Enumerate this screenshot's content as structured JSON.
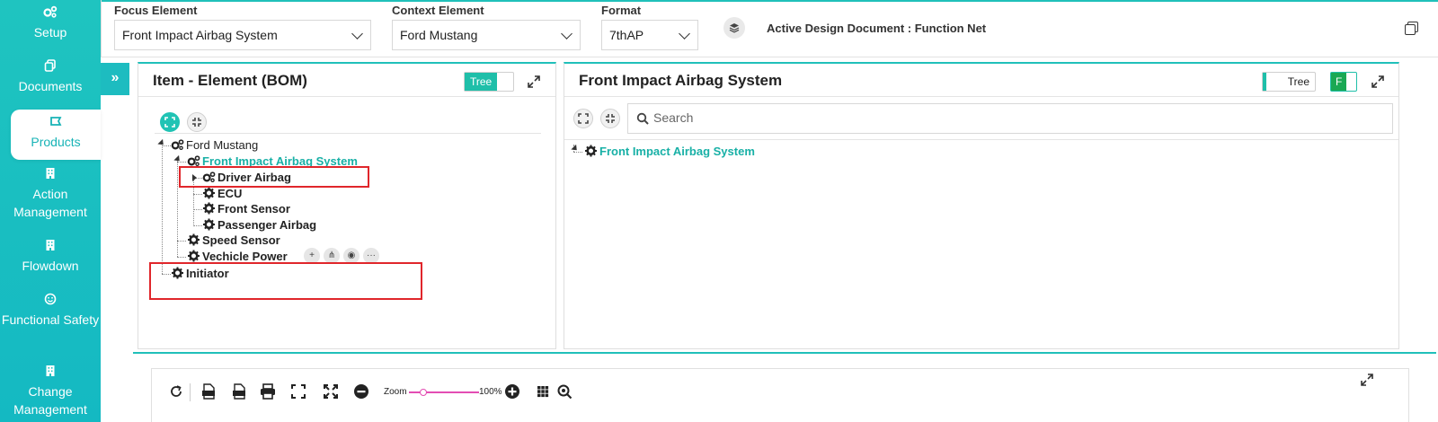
{
  "sidebar": {
    "items": [
      {
        "label": "Setup",
        "icon": "gears-icon"
      },
      {
        "label": "Documents",
        "icon": "copy-icon"
      },
      {
        "label": "Products",
        "icon": "ticket-icon",
        "active": true
      },
      {
        "label": "Action Management",
        "icon": "building-icon"
      },
      {
        "label": "Flowdown",
        "icon": "building-icon"
      },
      {
        "label": "Functional Safety",
        "icon": "smiley-icon"
      },
      {
        "label": "Change Management",
        "icon": "building-icon"
      }
    ]
  },
  "topbar": {
    "focus_label": "Focus Element",
    "focus_value": "Front Impact Airbag System",
    "context_label": "Context Element",
    "context_value": "Ford Mustang",
    "format_label": "Format",
    "format_value": "7thAP",
    "active_doc": "Active Design Document : Function Net"
  },
  "left_panel": {
    "title": "Item - Element (BOM)",
    "toggle_label": "Tree",
    "tree": [
      {
        "label": "Ford Mustang",
        "level": 0
      },
      {
        "label": "Front Impact Airbag System",
        "level": 1
      },
      {
        "label": "Driver Airbag",
        "level": 2
      },
      {
        "label": "ECU",
        "level": 2
      },
      {
        "label": "Front Sensor",
        "level": 2
      },
      {
        "label": "Passenger Airbag",
        "level": 2
      },
      {
        "label": "Speed Sensor",
        "level": 1
      },
      {
        "label": "Vechicle Power",
        "level": 1
      },
      {
        "label": "Initiator",
        "level": 0
      }
    ],
    "row_actions": [
      "+",
      "⋔",
      "◉",
      "···"
    ]
  },
  "right_panel": {
    "title": "Front Impact Airbag System",
    "toggle_label": "Tree",
    "badge": "F",
    "search_placeholder": "Search",
    "tree": [
      {
        "label": "Front Impact Airbag System"
      }
    ]
  },
  "bottom_toolbar": {
    "zoom_label": "Zoom",
    "zoom_value": "100%",
    "zoom_fraction": 0.2
  },
  "colors": {
    "accent": "#20c0ba",
    "highlight": "#e0262b",
    "zoom": "#e34db3"
  }
}
